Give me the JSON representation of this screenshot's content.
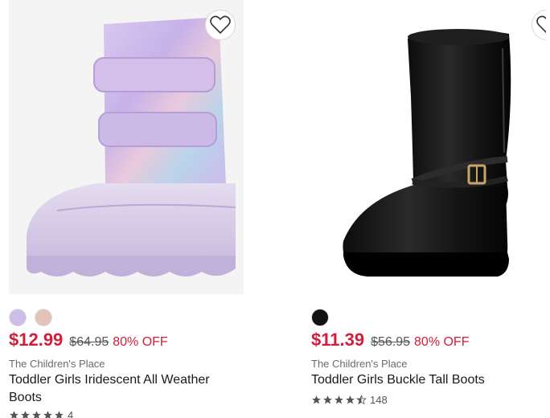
{
  "products": [
    {
      "swatches": [
        "#cdbde8",
        "#e3c4b9"
      ],
      "price_sale": "$12.99",
      "price_original": "$64.95",
      "discount": "80% OFF",
      "brand": "The Children's Place",
      "title": "Toddler Girls Iridescent All Weather Boots",
      "rating_stars": 5,
      "review_count": "4",
      "icons": {
        "favorite": "heart-outline-icon",
        "rating": "star-icon"
      }
    },
    {
      "swatches": [
        "#111111"
      ],
      "price_sale": "$11.39",
      "price_original": "$56.95",
      "discount": "80% OFF",
      "brand": "The Children's Place",
      "title": "Toddler Girls Buckle Tall Boots",
      "rating_stars": 4.5,
      "review_count": "148",
      "icons": {
        "favorite": "heart-outline-icon",
        "rating": "star-icon"
      }
    }
  ],
  "colors": {
    "sale": "#d11f3a",
    "text": "#1a1a1a",
    "muted": "#6b6b6b"
  }
}
